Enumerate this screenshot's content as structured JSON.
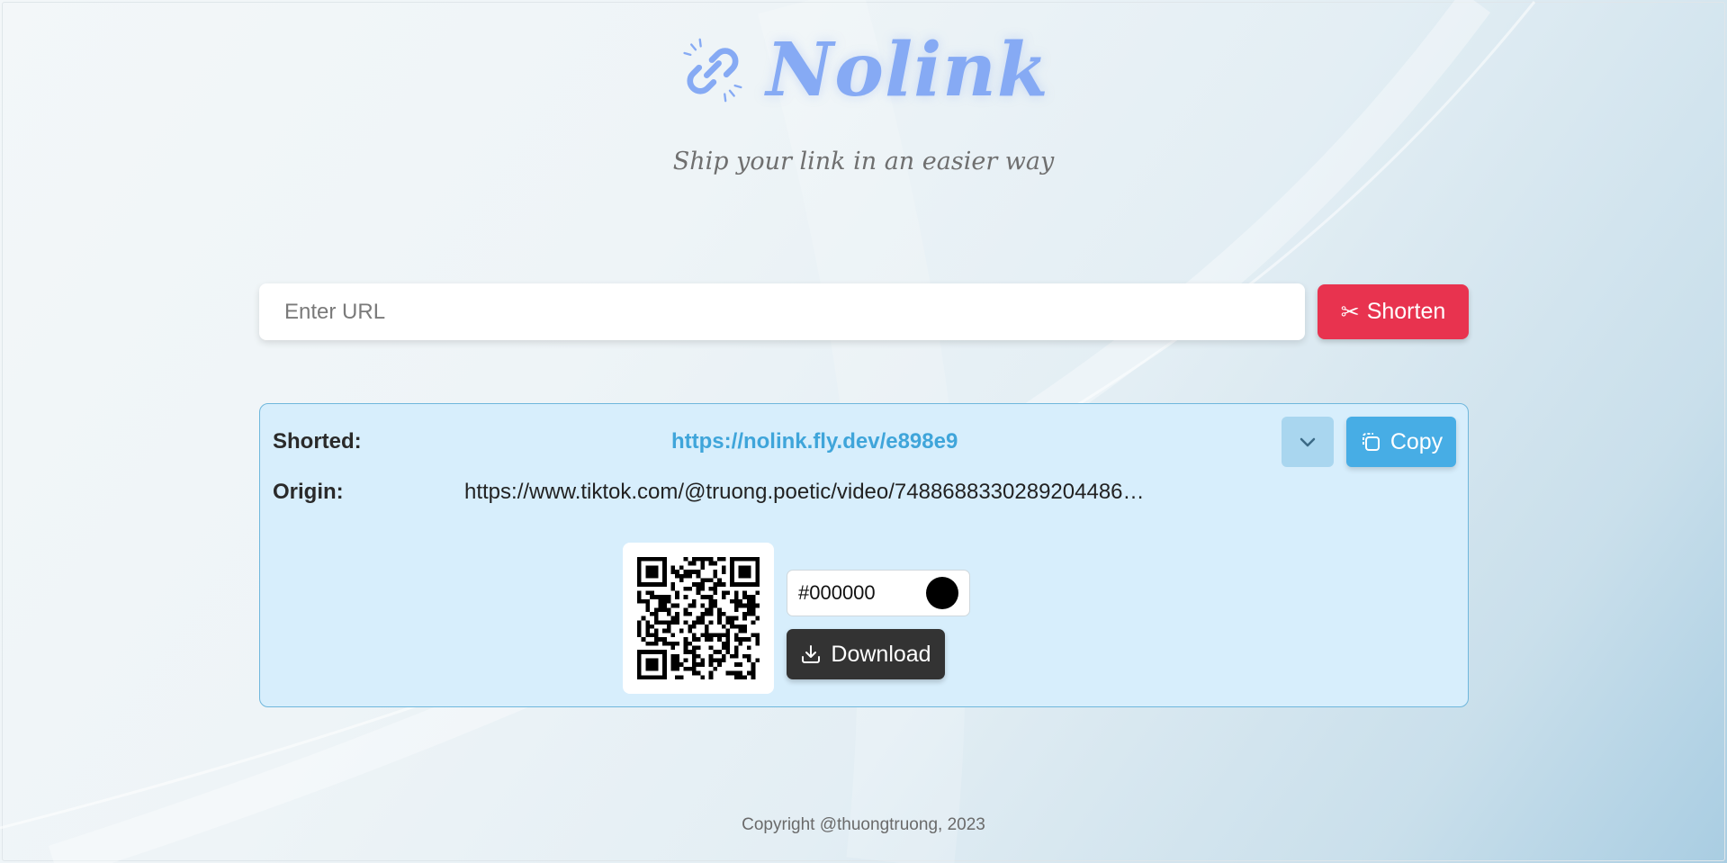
{
  "brand": {
    "name": "Nolink",
    "icon": "link-icon",
    "color": "#86aaf4"
  },
  "tagline": "Ship your link in an easier way",
  "url_form": {
    "placeholder": "Enter URL",
    "value": "",
    "shorten_label": "Shorten",
    "shorten_icon": "scissors-icon",
    "shorten_color": "#e8334f"
  },
  "result": {
    "shorted_label": "Shorted:",
    "shorted_url": "https://nolink.fly.dev/e898e9",
    "origin_label": "Origin:",
    "origin_url": "https://www.tiktok.com/@truong.poetic/video/7488688330289204486…",
    "toggle_icon": "chevron-down-icon",
    "copy_label": "Copy",
    "copy_icon": "copy-icon",
    "copy_color": "#47ade5",
    "qr": {
      "color_value": "#000000",
      "download_label": "Download",
      "download_icon": "download-icon"
    }
  },
  "footer": {
    "copyright": "Copyright @thuongtruong, 2023"
  }
}
